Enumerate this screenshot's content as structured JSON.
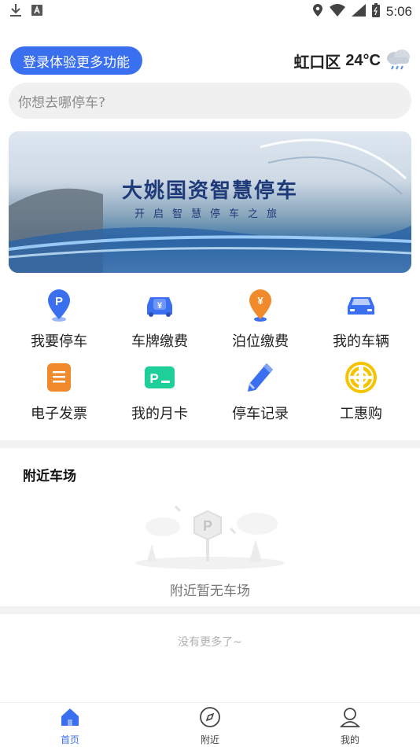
{
  "status_bar": {
    "time": "5:06"
  },
  "header": {
    "login_button": "登录体验更多功能",
    "weather": {
      "district": "虹口区",
      "temperature": "24°C",
      "icon": "cloud-rain-icon"
    }
  },
  "search": {
    "placeholder": "你想去哪停车?"
  },
  "banner": {
    "title": "大姚国资智慧停车",
    "subtitle": "开启智慧停车之旅"
  },
  "services": [
    {
      "label": "我要停车",
      "icon": "parking-pin-icon"
    },
    {
      "label": "车牌缴费",
      "icon": "car-yuan-icon"
    },
    {
      "label": "泊位缴费",
      "icon": "yuan-pin-icon"
    },
    {
      "label": "我的车辆",
      "icon": "car-icon"
    },
    {
      "label": "电子发票",
      "icon": "invoice-icon"
    },
    {
      "label": "我的月卡",
      "icon": "monthly-card-icon"
    },
    {
      "label": "停车记录",
      "icon": "pen-record-icon"
    },
    {
      "label": "工惠购",
      "icon": "union-badge-icon"
    }
  ],
  "nearby": {
    "title": "附近车场",
    "empty_text": "附近暂无车场",
    "no_more": "没有更多了~"
  },
  "tabbar": {
    "items": [
      {
        "label": "首页",
        "icon": "home-icon",
        "active": true
      },
      {
        "label": "附近",
        "icon": "compass-icon",
        "active": false
      },
      {
        "label": "我的",
        "icon": "user-icon",
        "active": false
      }
    ]
  },
  "colors": {
    "accent": "#3a6ff0",
    "orange": "#f08a2a",
    "green": "#1fcf9a",
    "yellow": "#f5c400"
  }
}
